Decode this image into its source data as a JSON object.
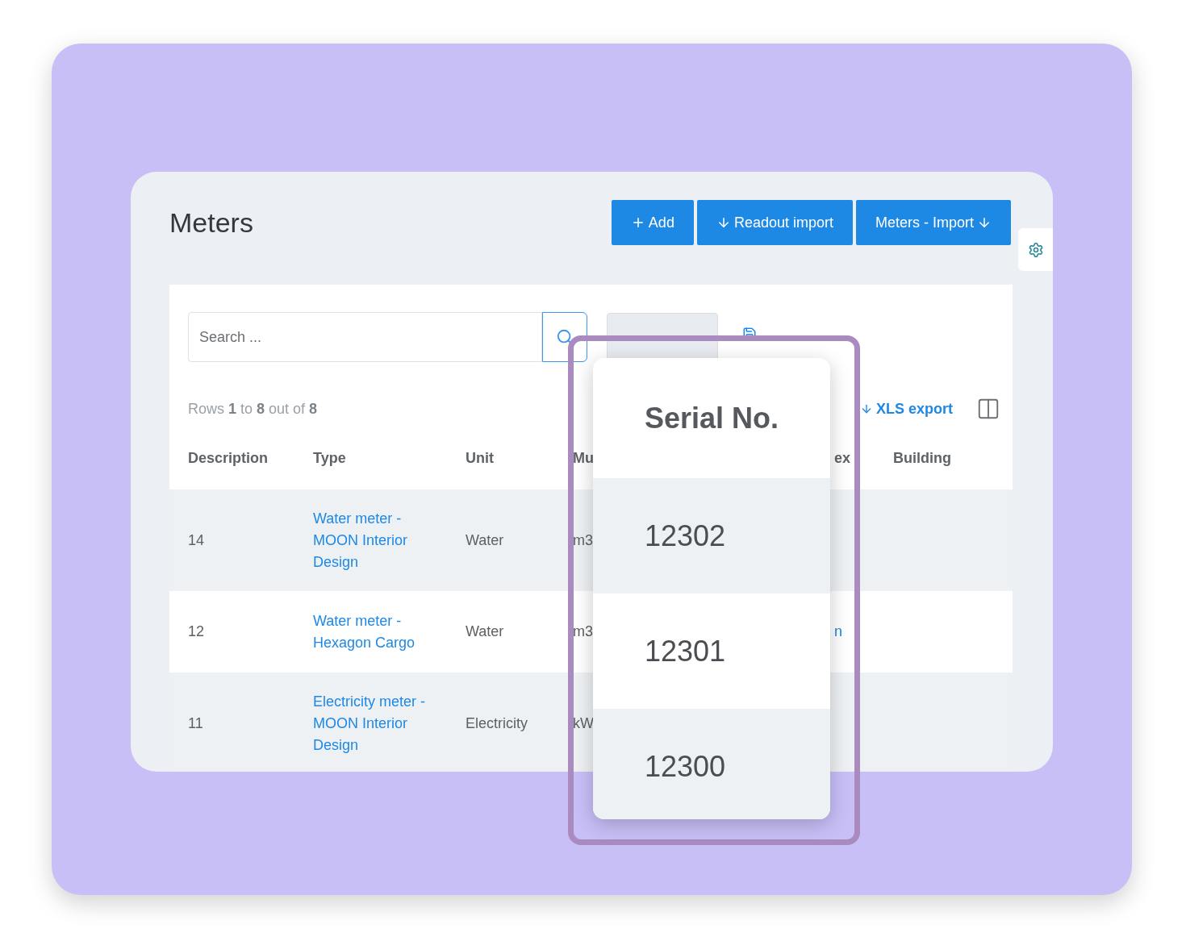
{
  "page": {
    "title": "Meters"
  },
  "actions": [
    {
      "label": "Add",
      "kind": "add"
    },
    {
      "label": "Readout import",
      "kind": "import-before"
    },
    {
      "label": "Meters - Import",
      "kind": "import-after"
    }
  ],
  "search": {
    "placeholder": "Search ..."
  },
  "summary": "Rows **1** to **8** out of **8**",
  "xls_export": "XLS export",
  "table": {
    "columns": [
      "Description",
      "Type",
      "Unit",
      "Mu",
      "ex",
      "Building"
    ],
    "rows": [
      {
        "description": "14",
        "type": "Water meter - MOON Interior Design",
        "unit": "Water",
        "column_4": "m3"
      },
      {
        "description": "12",
        "type": "Water meter - Hexagon Cargo",
        "unit": "Water",
        "column_4": "m3",
        "column_5": "n"
      },
      {
        "description": "11",
        "type": "Electricity meter - MOON Interior Design",
        "unit": "Electricity",
        "column_4": "kW"
      }
    ]
  },
  "serial_popup": {
    "title": "Serial No.",
    "values": [
      "12302",
      "12301",
      "12300"
    ]
  }
}
